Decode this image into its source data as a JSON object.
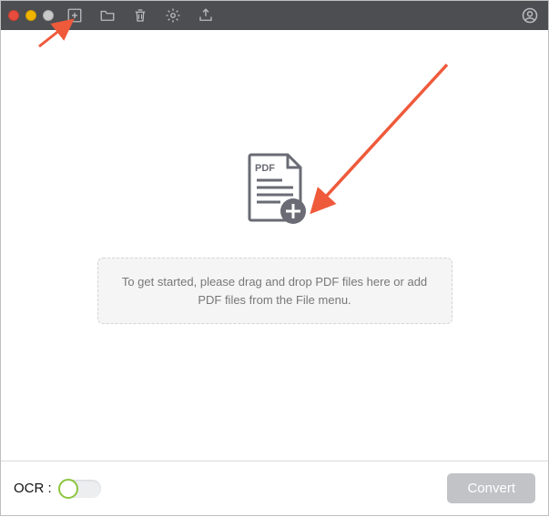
{
  "toolbar": {
    "icons": {
      "add_file": "add-file-icon",
      "open_folder": "folder-icon",
      "delete": "trash-icon",
      "settings": "gear-icon",
      "export": "export-icon",
      "account": "account-icon"
    }
  },
  "dropzone": {
    "file_badge": "PDF",
    "message": "To get started, please drag and drop PDF files here or add PDF files from the File menu."
  },
  "bottom": {
    "ocr_label": "OCR :",
    "ocr_enabled": false,
    "convert_label": "Convert"
  }
}
